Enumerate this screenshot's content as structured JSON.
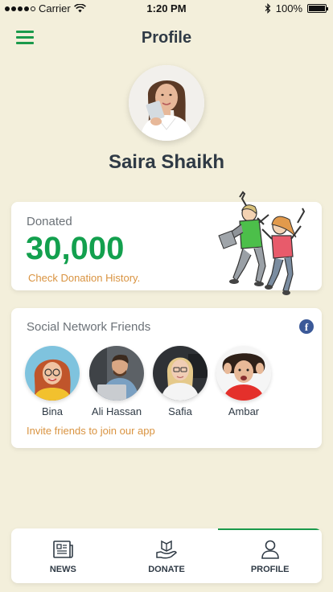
{
  "status_bar": {
    "carrier": "Carrier",
    "time": "1:20 PM",
    "battery": "100%"
  },
  "header": {
    "title": "Profile",
    "menu_icon": "hamburger-menu-icon"
  },
  "profile": {
    "name": "Saira Shaikh",
    "avatar": "user-avatar"
  },
  "donation": {
    "label": "Donated",
    "amount": "30,000",
    "history_link": "Check Donation History.",
    "illustration": "jumping-people-illustration"
  },
  "friends": {
    "title": "Social Network Friends",
    "network_icon": "facebook-icon",
    "list": [
      {
        "name": "Bina"
      },
      {
        "name": "Ali Hassan"
      },
      {
        "name": "Safia"
      },
      {
        "name": "Ambar"
      }
    ],
    "invite_link": "Invite friends to join our app"
  },
  "tabs": [
    {
      "label": "NEWS",
      "icon": "newspaper-icon",
      "active": false
    },
    {
      "label": "DONATE",
      "icon": "donate-hand-icon",
      "active": false
    },
    {
      "label": "PROFILE",
      "icon": "user-profile-icon",
      "active": true
    }
  ],
  "colors": {
    "background": "#f3efdb",
    "accent_green": "#13a04e",
    "link_orange": "#d99340",
    "facebook_blue": "#3b5998"
  }
}
